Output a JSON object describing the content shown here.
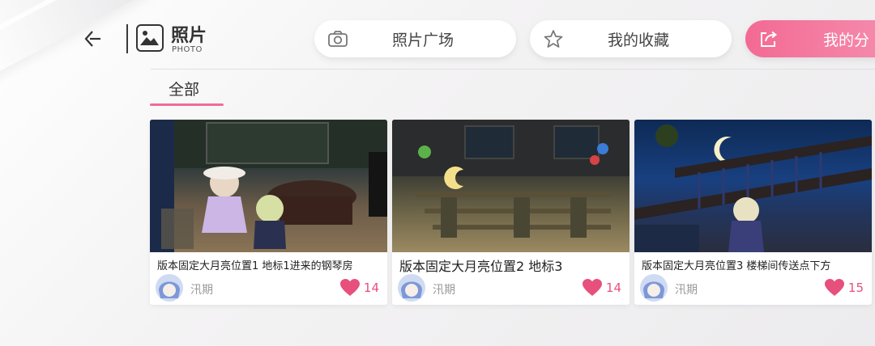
{
  "header": {
    "title": "照片",
    "subtitle": "PHOTO"
  },
  "nav": [
    {
      "label": "照片广场",
      "icon": "camera-icon",
      "active": false
    },
    {
      "label": "我的收藏",
      "icon": "star-icon",
      "active": false
    },
    {
      "label": "我的分",
      "icon": "share-icon",
      "active": true
    }
  ],
  "tabs": [
    {
      "label": "全部",
      "active": true
    }
  ],
  "cards": [
    {
      "caption": "版本固定大月亮位置1 地标1进来的钢琴房",
      "author": "汛期",
      "likes": "14"
    },
    {
      "caption": "版本固定大月亮位置2 地标3",
      "author": "汛期",
      "likes": "14"
    },
    {
      "caption": "版本固定大月亮位置3 楼梯间传送点下方",
      "author": "汛期",
      "likes": "15"
    }
  ],
  "colors": {
    "accent": "#f06c95",
    "like": "#e7507c"
  }
}
